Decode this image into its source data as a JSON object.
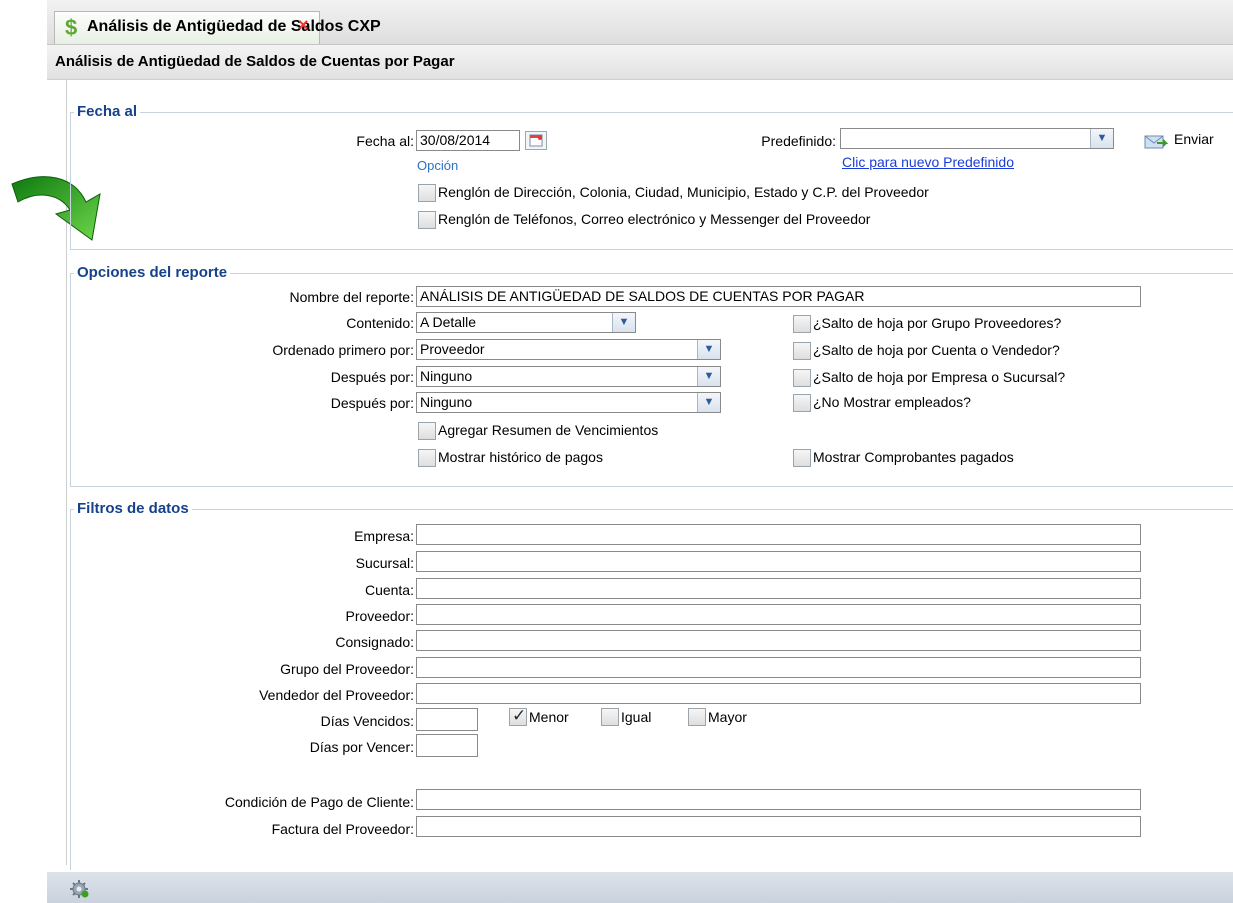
{
  "tab": {
    "title": "Análisis de Antigüedad de Saldos CXP",
    "close": "×",
    "icon": "dollar-icon"
  },
  "header": {
    "title": "Análisis de Antigüedad de Saldos de Cuentas por Pagar"
  },
  "fecha": {
    "legend": "Fecha al",
    "fecha_label": "Fecha al:",
    "fecha_value": "30/08/2014",
    "opcion": "Opción",
    "predefinido_label": "Predefinido:",
    "predefinido_value": "",
    "predefinido_link": "Clic para nuevo Predefinido",
    "enviar": "Enviar",
    "chk_direccion": "Renglón de Dirección, Colonia, Ciudad, Municipio, Estado y C.P. del Proveedor",
    "chk_telefonos": "Renglón de Teléfonos, Correo electrónico y Messenger del Proveedor"
  },
  "opciones": {
    "legend": "Opciones del reporte",
    "nombre_label": "Nombre del reporte:",
    "nombre_value": "ANÁLISIS DE ANTIGÜEDAD DE SALDOS DE CUENTAS POR PAGAR",
    "contenido_label": "Contenido:",
    "contenido_value": "A Detalle",
    "ordenado_label": "Ordenado primero por:",
    "ordenado_value": "Proveedor",
    "despues1_label": "Después por:",
    "despues1_value": "Ninguno",
    "despues2_label": "Después por:",
    "despues2_value": "Ninguno",
    "chk_salto_grupo": "¿Salto de hoja por Grupo Proveedores?",
    "chk_salto_cuenta": "¿Salto de hoja por Cuenta o Vendedor?",
    "chk_salto_empresa": "¿Salto de hoja por Empresa o Sucursal?",
    "chk_no_mostrar": "¿No Mostrar empleados?",
    "chk_resumen": "Agregar Resumen de Vencimientos",
    "chk_historico": "Mostrar histórico de pagos",
    "chk_comprobantes": "Mostrar Comprobantes pagados"
  },
  "filtros": {
    "legend": "Filtros de datos",
    "empresa": "Empresa:",
    "sucursal": "Sucursal:",
    "cuenta": "Cuenta:",
    "proveedor": "Proveedor:",
    "consignado": "Consignado:",
    "grupo": "Grupo del Proveedor:",
    "vendedor": "Vendedor del Proveedor:",
    "dias_vencidos": "Días Vencidos:",
    "menor": "Menor",
    "igual": "Igual",
    "mayor": "Mayor",
    "dias_vencer": "Días por Vencer:",
    "condicion": "Condición de Pago de Cliente:",
    "factura": "Factura del Proveedor:"
  },
  "colors": {
    "legend": "#15428b",
    "link": "#1a3cd6",
    "arrow": "#3aa01f"
  }
}
